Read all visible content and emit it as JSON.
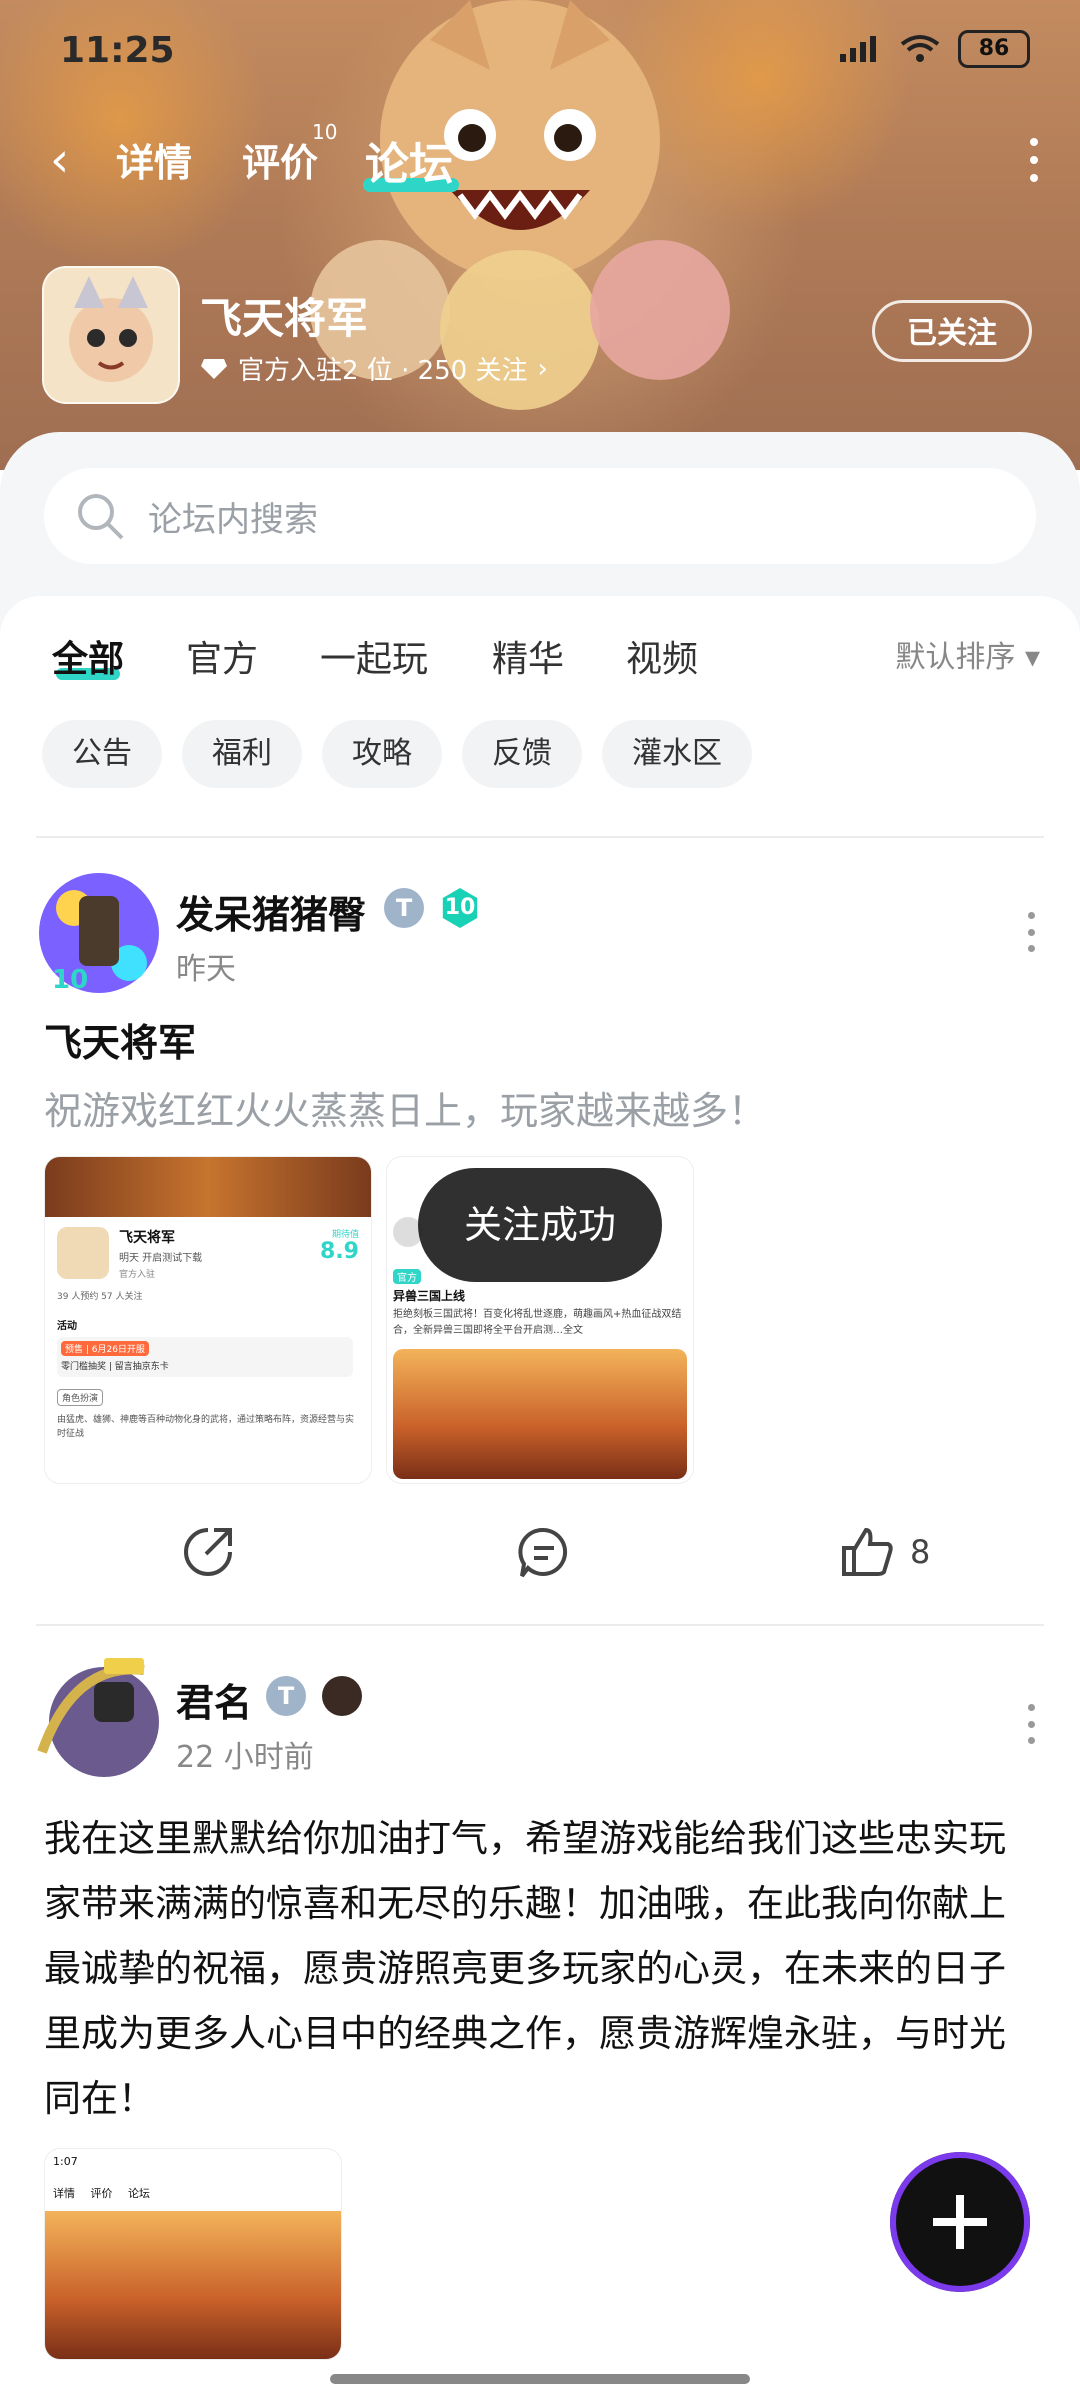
{
  "status_bar": {
    "time": "11:25",
    "battery": "86"
  },
  "nav": {
    "back_icon": "chevron-left",
    "tabs": [
      {
        "label": "详情"
      },
      {
        "label": "评价",
        "badge": "10"
      },
      {
        "label": "论坛"
      }
    ],
    "active_tab": "论坛"
  },
  "game": {
    "title": "飞天将军",
    "meta_rank": "官方入驻2 位 · 250 关注",
    "follow_label": "已关注"
  },
  "search": {
    "placeholder": "论坛内搜索"
  },
  "filter_tabs": [
    "全部",
    "官方",
    "一起玩",
    "精华",
    "视频"
  ],
  "sort_label": "默认排序",
  "chips": [
    "公告",
    "福利",
    "攻略",
    "反馈",
    "灌水区"
  ],
  "post1": {
    "author": "发呆猪猪臀",
    "time": "昨天",
    "level_badge": "10",
    "title": "飞天将军",
    "subtitle": "祝游戏红红火火蒸蒸日上，玩家越来越多！",
    "like_count": "8",
    "thumb1": {
      "game_name": "飞天将军",
      "line1": "明天 开启测试下载",
      "official": "官方入驻",
      "score_label": "期待值",
      "score": "8.9",
      "stats": "39 人预约    57 人关注",
      "activity": "活动",
      "badge_text": "预售 | 6月26日开服",
      "promo": "零门槛抽奖 | 留言抽京东卡",
      "tag": "角色扮演",
      "desc": "由猛虎、雄狮、神鹿等百种动物化身的武将，通过策略布阵，资源经营与实时征战"
    },
    "thumb2": {
      "text": "拒绝刻板三国武将！百变化将乱世逐鹿，萌趣画风+热血征战双结合，全新异兽三国即将全平台开启测…全文",
      "title_line": "异兽三国上线",
      "official": "官方"
    }
  },
  "toast": {
    "text": "关注成功"
  },
  "post2": {
    "author": "君名",
    "time": "22 小时前",
    "body": "我在这里默默给你加油打气，希望游戏能给我们这些忠实玩家带来满满的惊喜和无尽的乐趣！加油哦，在此我向你献上最诚挚的祝福，愿贵游照亮更多玩家的心灵，在未来的日子里成为更多人心目中的经典之作，愿贵游辉煌永驻，与时光同在！",
    "thumb": {
      "time": "1:07",
      "tabs": [
        "详情",
        "评价",
        "论坛"
      ]
    }
  },
  "colors": {
    "accent": "#2fd6c8",
    "toast_bg": "#1e1e1e",
    "fab_ring": "#7c3aed"
  }
}
